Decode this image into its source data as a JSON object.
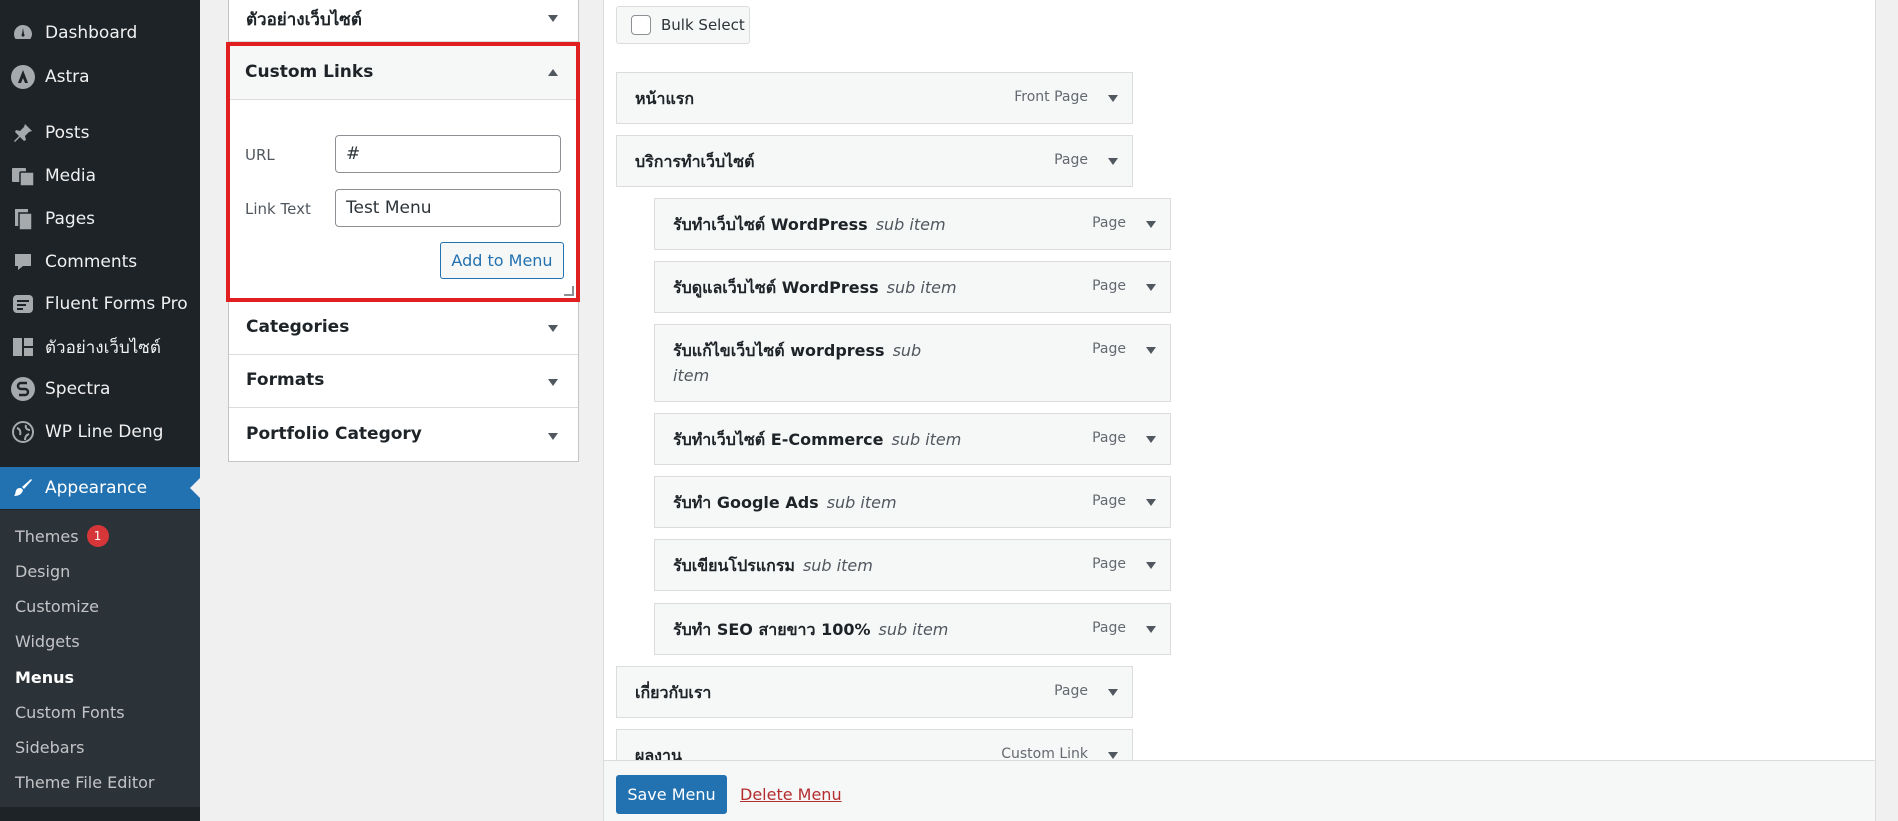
{
  "sidebar": {
    "items": [
      {
        "label": "Dashboard",
        "icon": "dashboard-icon"
      },
      {
        "label": "Astra",
        "icon": "astra-icon"
      },
      {
        "label": "Posts",
        "icon": "pin-icon"
      },
      {
        "label": "Media",
        "icon": "media-icon"
      },
      {
        "label": "Pages",
        "icon": "pages-icon"
      },
      {
        "label": "Comments",
        "icon": "comment-icon"
      },
      {
        "label": "Fluent Forms Pro",
        "icon": "forms-icon"
      },
      {
        "label": "ตัวอย่างเว็บไซต์",
        "icon": "layout-icon"
      },
      {
        "label": "Spectra",
        "icon": "spectra-icon"
      },
      {
        "label": "WP Line Deng",
        "icon": "globe-icon"
      },
      {
        "label": "Appearance",
        "icon": "brush-icon"
      }
    ],
    "submenu": [
      {
        "label": "Themes",
        "badge": "1"
      },
      {
        "label": "Design"
      },
      {
        "label": "Customize"
      },
      {
        "label": "Widgets"
      },
      {
        "label": "Menus"
      },
      {
        "label": "Custom Fonts"
      },
      {
        "label": "Sidebars"
      },
      {
        "label": "Theme File Editor"
      }
    ],
    "current_item": "Appearance",
    "current_sub": "Menus"
  },
  "accordion": {
    "top_section": "ตัวอย่างเว็บไซต์",
    "custom_links": {
      "title": "Custom Links",
      "url_label": "URL",
      "url_value": "#",
      "link_text_label": "Link Text",
      "link_text_value": "Test Menu",
      "add_button": "Add to Menu"
    },
    "sections": [
      "Categories",
      "Formats",
      "Portfolio Category"
    ]
  },
  "menu": {
    "bulk_select_label": "Bulk Select",
    "items": [
      {
        "title": "หน้าแรก",
        "sub": "",
        "type": "Front Page",
        "depth": 0
      },
      {
        "title": "บริการทำเว็บไซต์",
        "sub": "",
        "type": "Page",
        "depth": 0
      },
      {
        "title": "รับทำเว็บไซต์ WordPress",
        "sub": "sub item",
        "type": "Page",
        "depth": 1
      },
      {
        "title": "รับดูแลเว็บไซต์ WordPress",
        "sub": "sub item",
        "type": "Page",
        "depth": 1
      },
      {
        "title": "รับแก้ไขเว็บไซต์ wordpress",
        "sub": "sub item",
        "type": "Page",
        "depth": 1
      },
      {
        "title": "รับทำเว็บไซต์ E-Commerce",
        "sub": "sub item",
        "type": "Page",
        "depth": 1
      },
      {
        "title": "รับทำ Google Ads",
        "sub": "sub item",
        "type": "Page",
        "depth": 1
      },
      {
        "title": "รับเขียนโปรแกรม",
        "sub": "sub item",
        "type": "Page",
        "depth": 1
      },
      {
        "title": "รับทำ SEO สายขาว 100%",
        "sub": "sub item",
        "type": "Page",
        "depth": 1
      },
      {
        "title": "เกี่ยวกับเรา",
        "sub": "",
        "type": "Page",
        "depth": 0
      },
      {
        "title": "ผลงาน",
        "sub": "",
        "type": "Custom Link",
        "depth": 0
      }
    ],
    "save_button": "Save Menu",
    "delete_link": "Delete Menu"
  },
  "colors": {
    "sidebar_bg": "#1d2327",
    "submenu_bg": "#2c3338",
    "accent": "#2271b1",
    "highlight_box": "#e02020",
    "badge": "#d63638",
    "delete": "#b32d2e"
  }
}
